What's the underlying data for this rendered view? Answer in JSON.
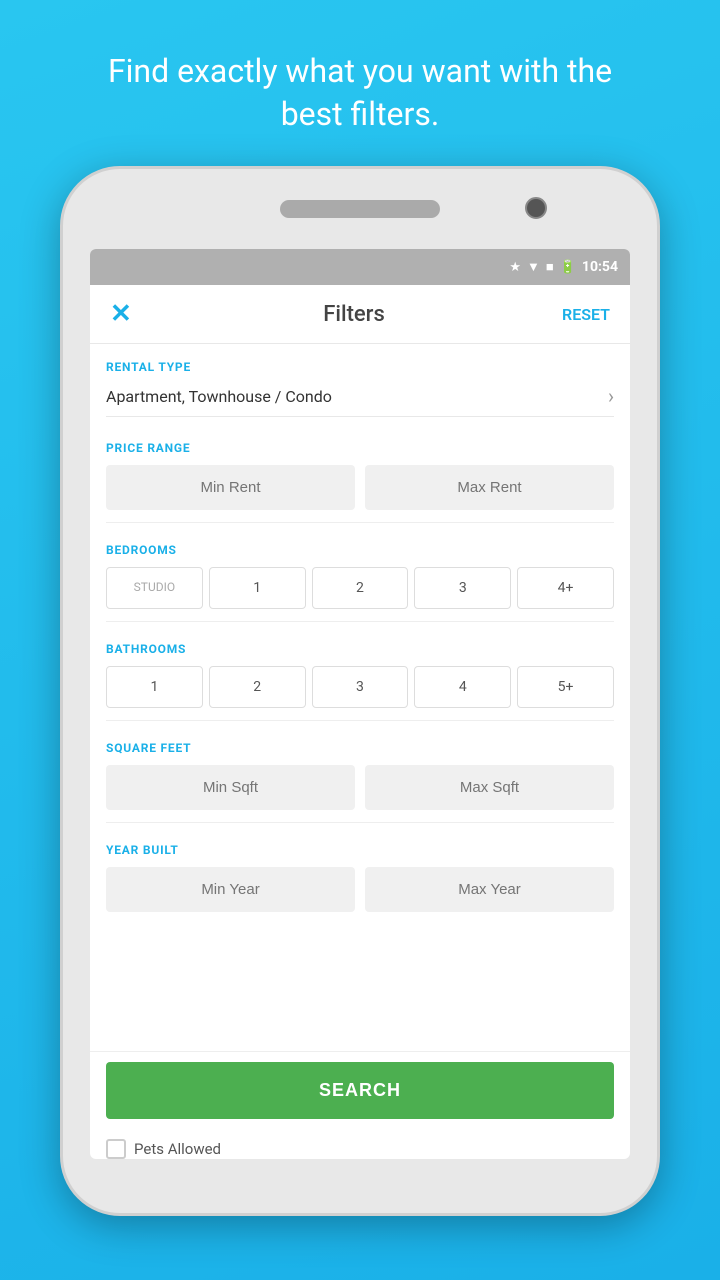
{
  "promo": {
    "text": "Find exactly what you want with the best filters."
  },
  "statusBar": {
    "time": "10:54",
    "icons": [
      "bluetooth",
      "wifi",
      "signal",
      "battery"
    ]
  },
  "header": {
    "close_label": "✕",
    "title_label": "Filters",
    "reset_label": "RESET"
  },
  "sections": {
    "rental_type": {
      "label": "RENTAL TYPE",
      "value": "Apartment, Townhouse / Condo"
    },
    "price_range": {
      "label": "PRICE RANGE",
      "min_placeholder": "Min Rent",
      "max_placeholder": "Max Rent"
    },
    "bedrooms": {
      "label": "BEDROOMS",
      "options": [
        "STUDIO",
        "1",
        "2",
        "3",
        "4+"
      ]
    },
    "bathrooms": {
      "label": "BATHROOMS",
      "options": [
        "1",
        "2",
        "3",
        "4",
        "5+"
      ]
    },
    "square_feet": {
      "label": "SQUARE FEET",
      "min_placeholder": "Min Sqft",
      "max_placeholder": "Max Sqft"
    },
    "year_built": {
      "label": "YEAR BUILT",
      "min_placeholder": "Min Year",
      "max_placeholder": "Max Year"
    }
  },
  "search_button": {
    "label": "SEARCH"
  },
  "pets_row": {
    "label": "Pets Allowed"
  }
}
